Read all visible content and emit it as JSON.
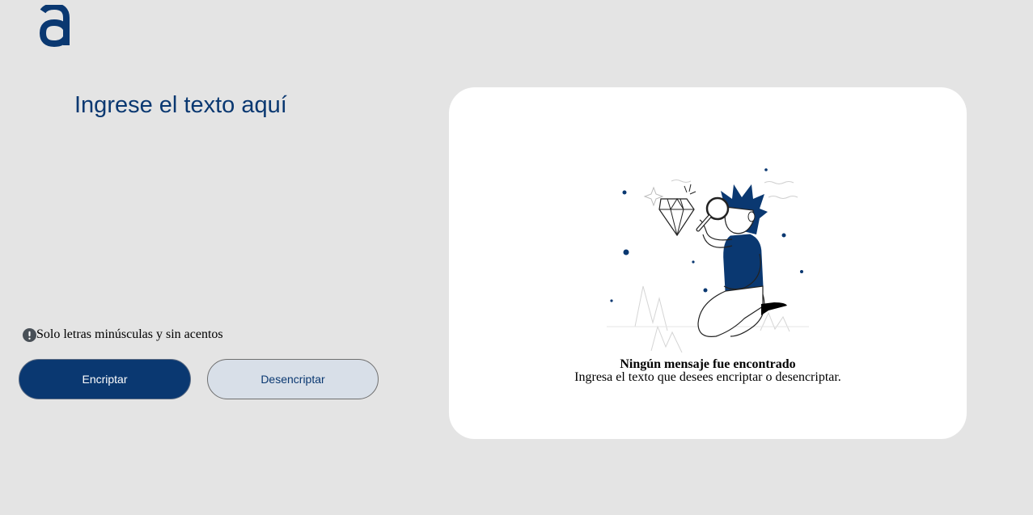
{
  "logo": {
    "icon": "alura-a-logo-icon",
    "color": "#0a3871"
  },
  "input": {
    "placeholder": "Ingrese el texto aquí",
    "value": ""
  },
  "hint": {
    "icon": "exclamation-circle-icon",
    "text": "Solo letras minúsculas y sin acentos"
  },
  "buttons": {
    "encrypt_label": "Encriptar",
    "decrypt_label": "Desencriptar"
  },
  "output": {
    "illustration": "person-with-magnifying-glass-illustration",
    "title": "Ningún mensaje fue encontrado",
    "body": "Ingresa el texto que desees encriptar o desencriptar."
  },
  "colors": {
    "background": "#e4e4e4",
    "accent": "#0a3871",
    "card": "#ffffff",
    "secondary_button": "#d8dfe8"
  }
}
